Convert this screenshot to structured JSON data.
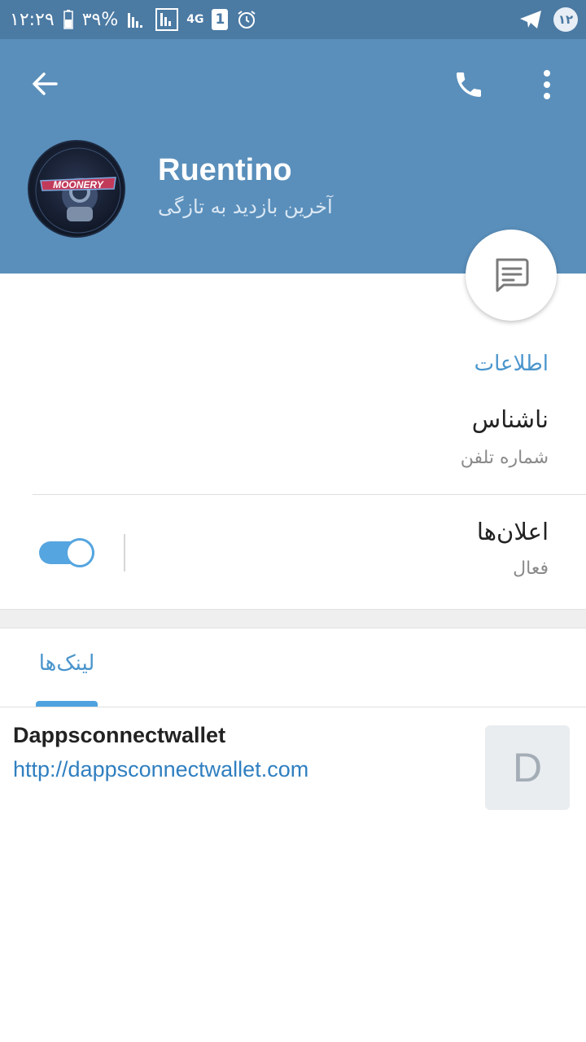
{
  "status_bar": {
    "time": "۱۲:۲۹",
    "battery": "۳۹%",
    "network": "4G",
    "sim": "1",
    "notification_count": "۱۲"
  },
  "header": {
    "name": "Ruentino",
    "status": "آخرین بازدید به تازگی",
    "avatar_text": "MOONERY"
  },
  "info": {
    "section_title": "اطلاعات",
    "username": "ناشناس",
    "username_caption": "شماره تلفن",
    "notifications_label": "اعلان‌ها",
    "notifications_state": "فعال",
    "notifications_on": true
  },
  "tabs": {
    "links_label": "لینک‌ها"
  },
  "links": [
    {
      "title": "Dappsconnectwallet",
      "url": "http://dappsconnectwallet.com",
      "thumb_letter": "D"
    }
  ],
  "colors": {
    "header_bg": "#5a8fbb",
    "status_bar_bg": "#4b7aa3",
    "accent": "#4a95cc",
    "link": "#2f7fc0"
  }
}
